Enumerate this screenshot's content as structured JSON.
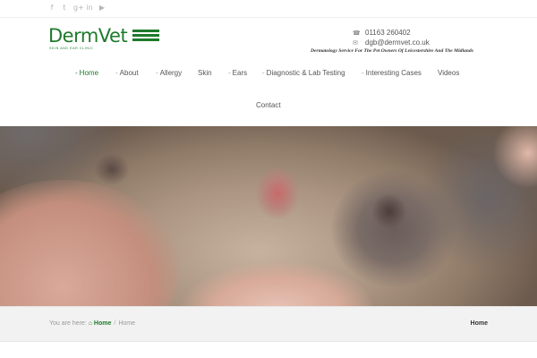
{
  "social": [
    {
      "icon": "facebook-icon",
      "glyph": "f"
    },
    {
      "icon": "twitter-icon",
      "glyph": "t"
    },
    {
      "icon": "google-plus-icon",
      "glyph": "g+"
    },
    {
      "icon": "linkedin-icon",
      "glyph": "in"
    },
    {
      "icon": "youtube-icon",
      "glyph": "▶"
    }
  ],
  "brand": {
    "name": "DermVet",
    "tagline_small": "SKIN AND EAR CLINIC",
    "color": "#1e7a2c"
  },
  "contact": {
    "phone": "01163 260402",
    "email": "dgb@dermvet.co.uk",
    "tagline": "Dermatology Service For The Pet Owners Of Leicestershire And The Midlands"
  },
  "nav": {
    "items": [
      {
        "label": "Home",
        "dash": "-",
        "active": true
      },
      {
        "label": "About",
        "dash": "-"
      },
      {
        "label": "Allergy",
        "dash": "-"
      },
      {
        "label": "Skin",
        "dash": ""
      },
      {
        "label": "Ears",
        "dash": "-"
      },
      {
        "label": "Diagnostic & Lab Testing",
        "dash": "-"
      },
      {
        "label": "Interesting Cases",
        "dash": "-"
      },
      {
        "label": "Videos",
        "dash": ""
      }
    ],
    "contact_label": "Contact"
  },
  "breadcrumb": {
    "prefix": "You are here:",
    "home_icon": "home-icon",
    "home_link": "Home",
    "separator": "/",
    "current": "Home",
    "page_title": "Home"
  }
}
